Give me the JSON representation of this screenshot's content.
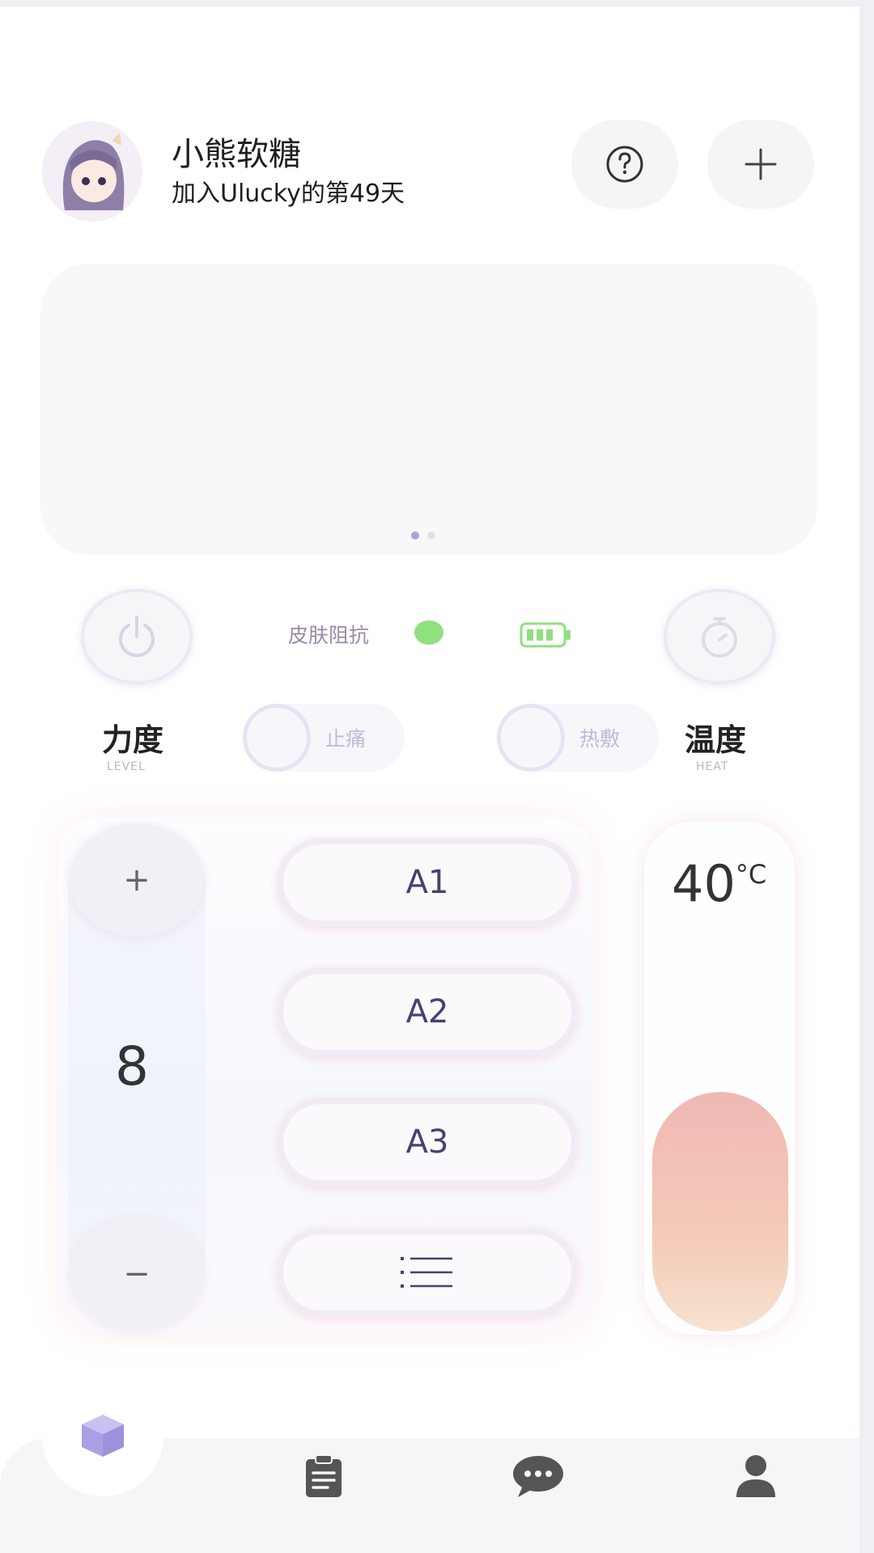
{
  "header": {
    "user_name": "小熊软糖",
    "days_text": "加入Ulucky的第49天"
  },
  "banner": {
    "page_count": 2,
    "active_page": 1
  },
  "status": {
    "skin_label": "皮肤阻抗",
    "skin_dot_color": "#8fe07f",
    "battery_color": "#8fe07f"
  },
  "controls": {
    "force_label": "力度",
    "force_sub": "LEVEL",
    "temp_label": "温度",
    "temp_sub": "HEAT",
    "pain_label": "止痛",
    "heat_label": "热敷"
  },
  "strength": {
    "plus": "+",
    "minus": "−",
    "level": "8",
    "modes": [
      "A1",
      "A2",
      "A3"
    ]
  },
  "temperature": {
    "value": "40",
    "unit": "°C"
  },
  "nav": {
    "items": [
      "home-icon",
      "document-icon",
      "chat-icon",
      "user-icon"
    ],
    "accent": "#a9a0e3",
    "inactive": "#555555"
  }
}
